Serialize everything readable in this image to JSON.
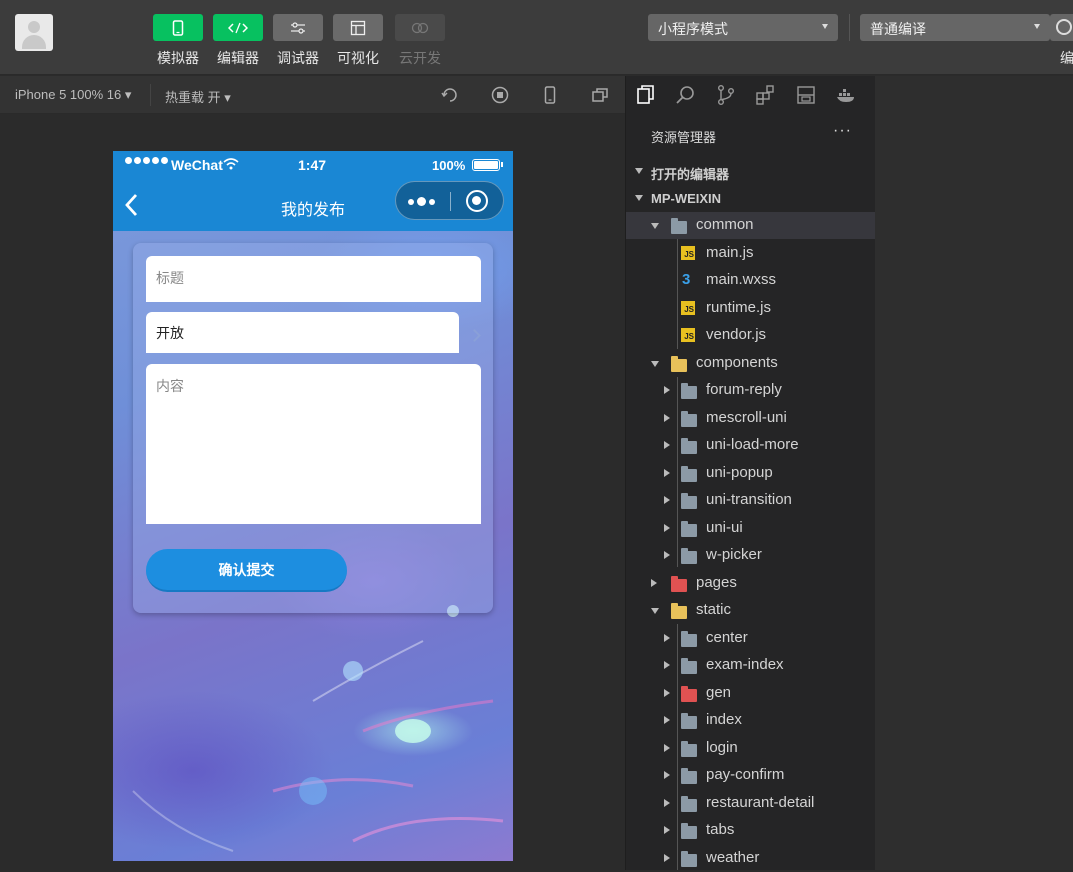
{
  "toolbar": {
    "tools": [
      {
        "label": "模拟器",
        "icon": "phone-icon",
        "style": "green"
      },
      {
        "label": "编辑器",
        "icon": "code-icon",
        "style": "green"
      },
      {
        "label": "调试器",
        "icon": "sliders-icon",
        "style": "gray"
      },
      {
        "label": "可视化",
        "icon": "layout-icon",
        "style": "gray"
      },
      {
        "label": "云开发",
        "icon": "cloud-icon",
        "style": "disabled"
      }
    ],
    "mode_select": "小程序模式",
    "compile_select": "普通编译",
    "edit_label_cut": "编"
  },
  "simulator": {
    "device": "iPhone 5 100% 16",
    "hot_reload": "热重载 开"
  },
  "phone": {
    "status": {
      "carrier": "WeChat",
      "time": "1:47",
      "battery": "100%"
    },
    "nav_title": "我的发布",
    "form": {
      "title_placeholder": "标题",
      "visibility_value": "开放",
      "content_placeholder": "内容",
      "submit_label": "确认提交"
    }
  },
  "explorer": {
    "header": "资源管理器",
    "more": "···",
    "open_editors": "打开的编辑器",
    "project": "MP-WEIXIN",
    "tree": [
      {
        "label": "common",
        "depth": 1,
        "kind": "folder-open",
        "expanded": true,
        "selected": true
      },
      {
        "label": "main.js",
        "depth": 2,
        "kind": "js"
      },
      {
        "label": "main.wxss",
        "depth": 2,
        "kind": "css"
      },
      {
        "label": "runtime.js",
        "depth": 2,
        "kind": "js"
      },
      {
        "label": "vendor.js",
        "depth": 2,
        "kind": "js"
      },
      {
        "label": "components",
        "depth": 1,
        "kind": "folder-yellow",
        "expanded": true
      },
      {
        "label": "forum-reply",
        "depth": 2,
        "kind": "folder"
      },
      {
        "label": "mescroll-uni",
        "depth": 2,
        "kind": "folder"
      },
      {
        "label": "uni-load-more",
        "depth": 2,
        "kind": "folder"
      },
      {
        "label": "uni-popup",
        "depth": 2,
        "kind": "folder"
      },
      {
        "label": "uni-transition",
        "depth": 2,
        "kind": "folder"
      },
      {
        "label": "uni-ui",
        "depth": 2,
        "kind": "folder"
      },
      {
        "label": "w-picker",
        "depth": 2,
        "kind": "folder"
      },
      {
        "label": "pages",
        "depth": 1,
        "kind": "folder-red",
        "expanded": false
      },
      {
        "label": "static",
        "depth": 1,
        "kind": "folder-yellow",
        "expanded": true
      },
      {
        "label": "center",
        "depth": 2,
        "kind": "folder"
      },
      {
        "label": "exam-index",
        "depth": 2,
        "kind": "folder"
      },
      {
        "label": "gen",
        "depth": 2,
        "kind": "folder-red"
      },
      {
        "label": "index",
        "depth": 2,
        "kind": "folder"
      },
      {
        "label": "login",
        "depth": 2,
        "kind": "folder"
      },
      {
        "label": "pay-confirm",
        "depth": 2,
        "kind": "folder"
      },
      {
        "label": "restaurant-detail",
        "depth": 2,
        "kind": "folder"
      },
      {
        "label": "tabs",
        "depth": 2,
        "kind": "folder"
      },
      {
        "label": "weather",
        "depth": 2,
        "kind": "folder"
      }
    ]
  }
}
